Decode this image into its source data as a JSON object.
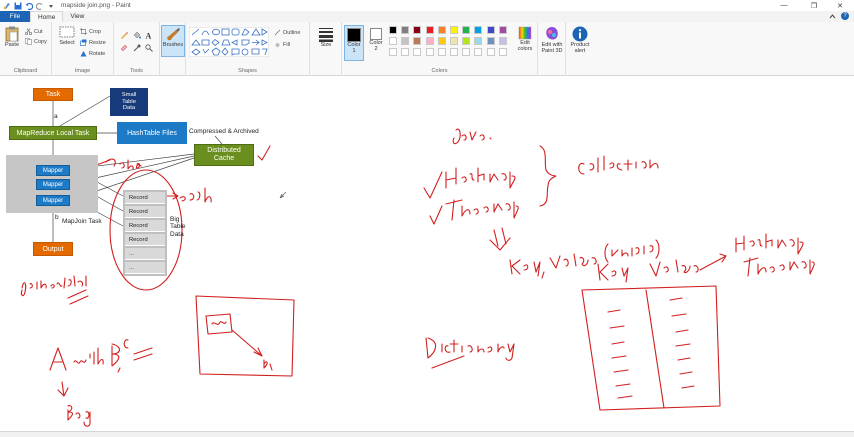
{
  "window": {
    "title": "mapside join.png - Paint",
    "controls": {
      "minimize": "—",
      "maximize": "❐",
      "close": "✕"
    }
  },
  "tabs": {
    "file": "File",
    "home": "Home",
    "view": "View"
  },
  "ribbon": {
    "clipboard": {
      "paste": "Paste",
      "cut": "Cut",
      "copy": "Copy",
      "label": "Clipboard"
    },
    "image": {
      "select": "Select",
      "crop": "Crop",
      "resize": "Resize",
      "rotate": "Rotate",
      "label": "Image"
    },
    "tools": {
      "label": "Tools"
    },
    "brushes": {
      "label": "Brushes"
    },
    "shapes": {
      "outline": "Outline",
      "fill": "Fill",
      "label": "Shapes"
    },
    "size": {
      "label": "Size"
    },
    "colors": {
      "color1": "Color\n1",
      "color1_line1": "Color",
      "color1_line2": "1",
      "color2_line1": "Color",
      "color2_line2": "2",
      "edit_colors_line1": "Edit",
      "edit_colors_line2": "colors",
      "label": "Colors",
      "color1_value": "#000000",
      "color2_value": "#ffffff",
      "palette_row1": [
        "#000000",
        "#7f7f7f",
        "#880015",
        "#ed1c24",
        "#ff7f27",
        "#fff200",
        "#22b14c",
        "#00a2e8",
        "#3f48cc",
        "#a349a4"
      ],
      "palette_row2": [
        "#ffffff",
        "#c3c3c3",
        "#b97a57",
        "#ffaec9",
        "#ffc90e",
        "#efe4b0",
        "#b5e61d",
        "#99d9ea",
        "#7092be",
        "#c8bfe7"
      ]
    },
    "paint3d": {
      "line1": "Edit with",
      "line2": "Paint 3D"
    },
    "product_alert": {
      "line1": "Product",
      "line2": "alert"
    }
  },
  "diagram": {
    "task": "Task",
    "small_table": {
      "line1": "Small",
      "line2": "Table",
      "line3": "Data"
    },
    "label_a": "a",
    "mapreduce_local_task": "MapReduce Local Task",
    "hashtable_files": "HashTable Files",
    "compressed_archived": "Compressed & Archived",
    "distributed_cache": {
      "line1": "Distributed",
      "line2": "Cache"
    },
    "mappers": [
      "Mapper",
      "Mapper",
      "Mapper"
    ],
    "records": [
      "Record",
      "Record",
      "Record",
      "Record",
      "...",
      "..."
    ],
    "big_table": {
      "line1": "Big",
      "line2": "Table",
      "line3": "Data"
    },
    "label_b": "b",
    "mapjoin_task": "MapJoin Task",
    "output": "Output"
  },
  "ink_color": "#d21f1f"
}
